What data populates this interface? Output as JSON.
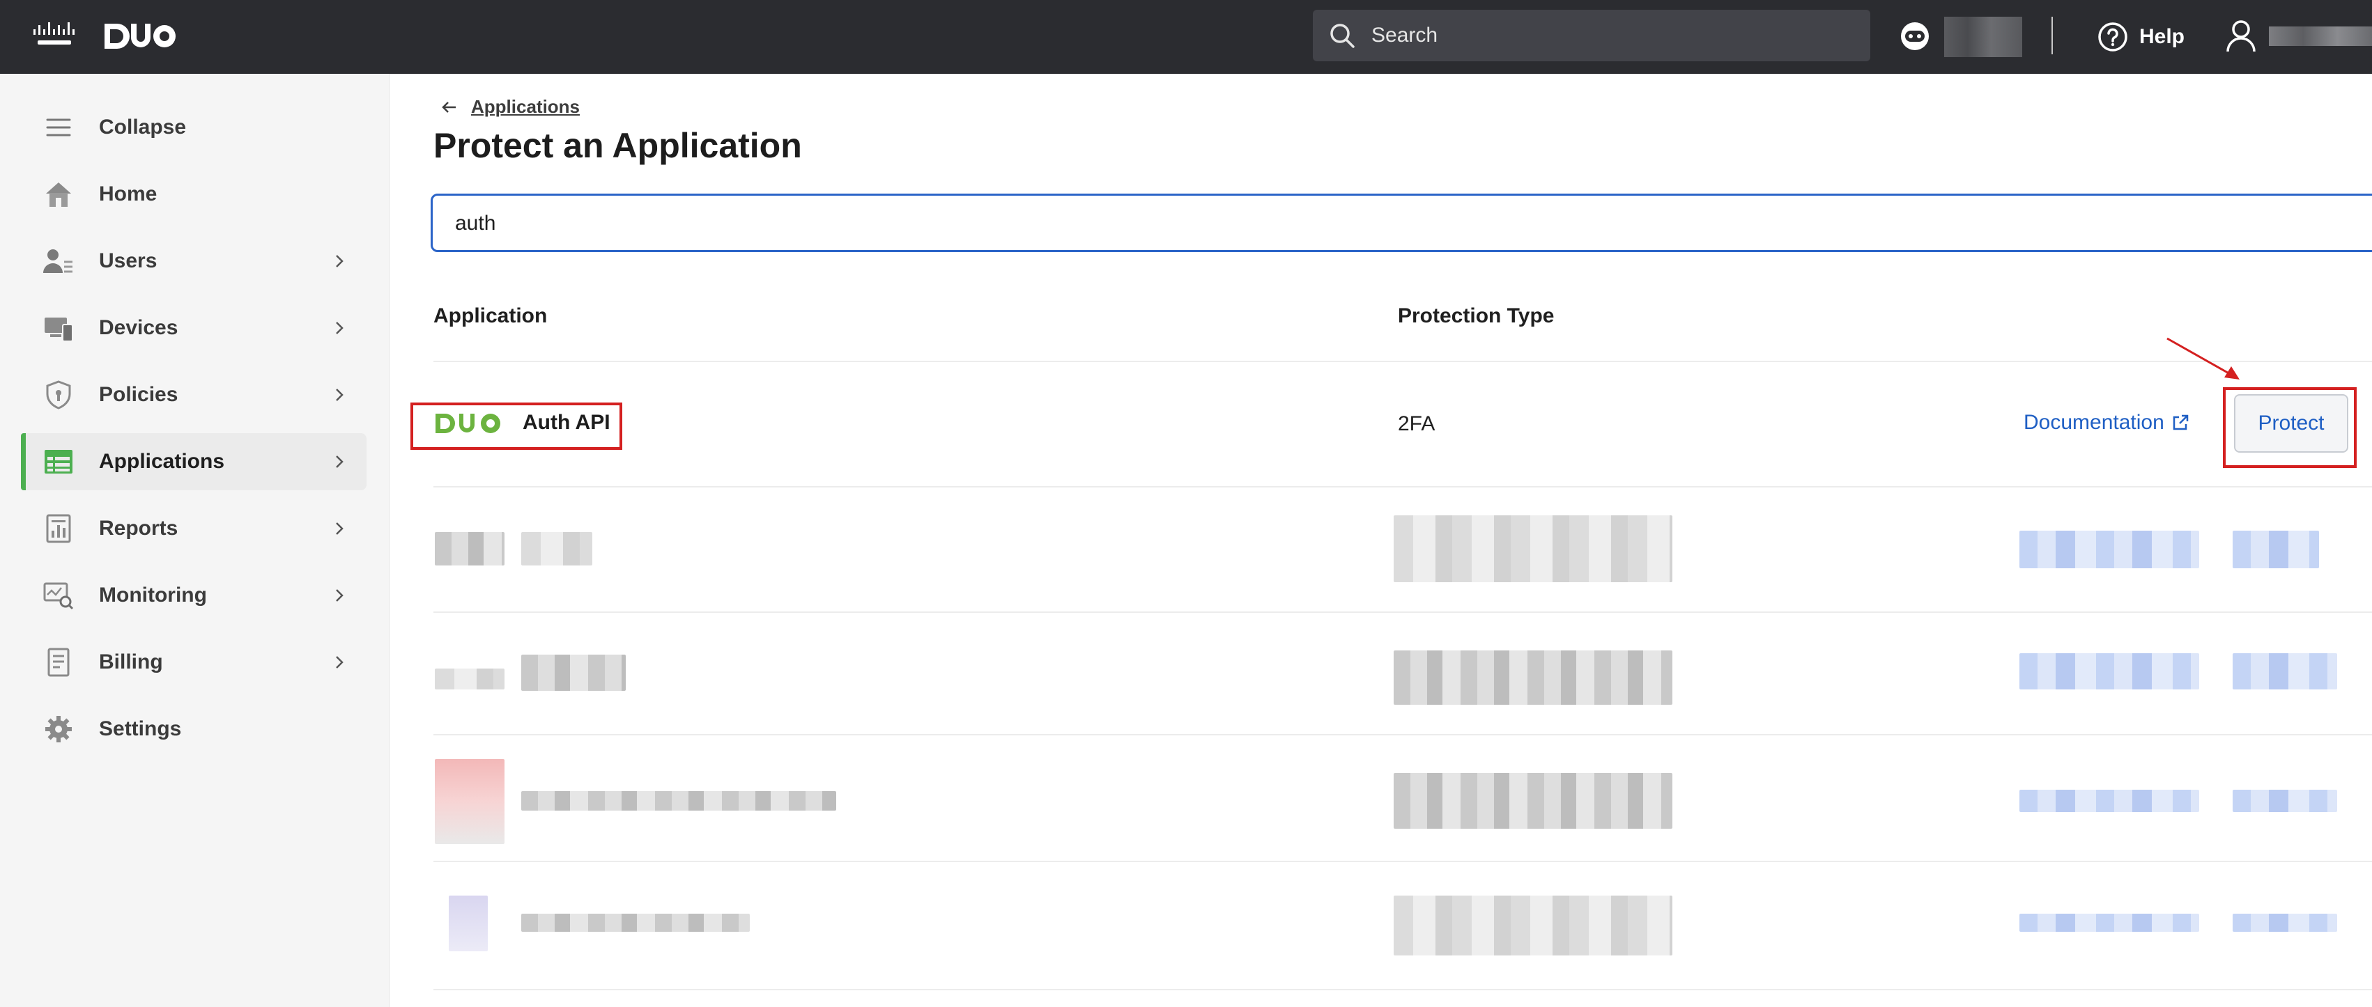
{
  "header": {
    "search_placeholder": "Search",
    "help_label": "Help"
  },
  "sidebar": {
    "items": [
      {
        "label": "Collapse",
        "icon": "hamburger-icon"
      },
      {
        "label": "Home",
        "icon": "home-icon"
      },
      {
        "label": "Users",
        "icon": "users-icon"
      },
      {
        "label": "Devices",
        "icon": "devices-icon"
      },
      {
        "label": "Policies",
        "icon": "shield-icon"
      },
      {
        "label": "Applications",
        "icon": "applications-icon",
        "active": true
      },
      {
        "label": "Reports",
        "icon": "reports-icon"
      },
      {
        "label": "Monitoring",
        "icon": "monitoring-icon"
      },
      {
        "label": "Billing",
        "icon": "billing-icon"
      },
      {
        "label": "Settings",
        "icon": "gear-icon"
      }
    ]
  },
  "main": {
    "breadcrumb": "Applications",
    "title": "Protect an Application",
    "filter_value": "auth",
    "columns": [
      "Application",
      "Protection Type"
    ],
    "rows": [
      {
        "app_name": "Auth API",
        "protection_type": "2FA",
        "doc_label": "Documentation",
        "action_label": "Protect"
      }
    ]
  },
  "colors": {
    "topbar": "#2b2c30",
    "accent_green": "#4caf50",
    "link_blue": "#1f5fc4",
    "highlight_red": "#d42020"
  }
}
